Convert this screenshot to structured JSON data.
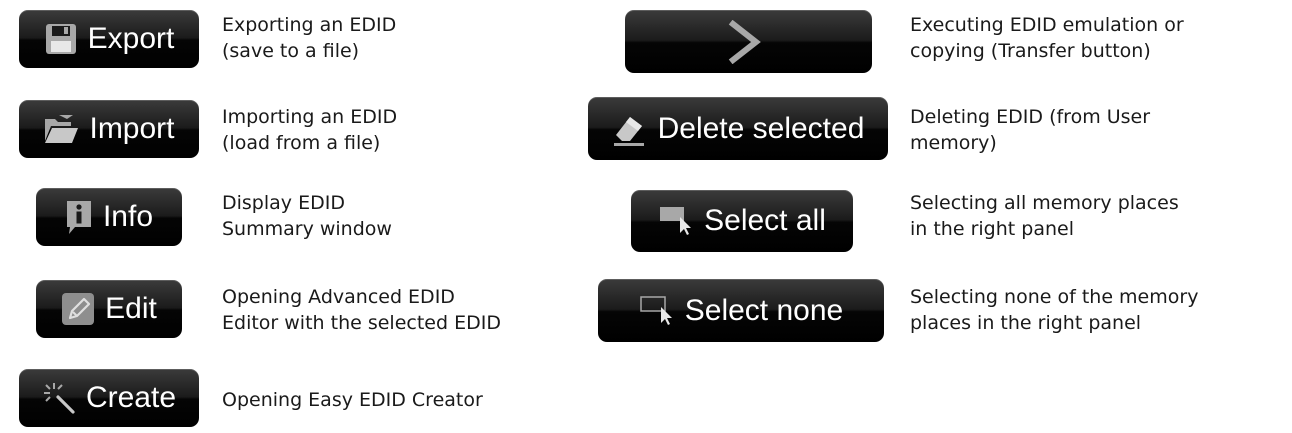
{
  "left_column": [
    {
      "label": "Export",
      "icon": "save-disk-icon",
      "desc": [
        "Exporting an EDID",
        "(save to a file)"
      ]
    },
    {
      "label": "Import",
      "icon": "open-folder-icon",
      "desc": [
        "Importing an EDID",
        "(load from a file)"
      ]
    },
    {
      "label": "Info",
      "icon": "info-bubble-icon",
      "desc": [
        "Display EDID",
        "Summary window"
      ]
    },
    {
      "label": "Edit",
      "icon": "pencil-icon",
      "desc": [
        "Opening Advanced EDID",
        "Editor with the selected EDID"
      ]
    },
    {
      "label": "Create",
      "icon": "magic-wand-icon",
      "desc": [
        "Opening Easy EDID Creator"
      ]
    }
  ],
  "right_column": [
    {
      "label": "",
      "icon": "chevron-right-icon",
      "desc": [
        "Executing EDID emulation or",
        "copying (Transfer button)"
      ]
    },
    {
      "label": "Delete selected",
      "icon": "eraser-icon",
      "desc": [
        "Deleting EDID (from User",
        "memory)"
      ]
    },
    {
      "label": "Select all",
      "icon": "select-all-icon",
      "desc": [
        "Selecting all memory places",
        "in the right panel"
      ]
    },
    {
      "label": "Select none",
      "icon": "select-none-icon",
      "desc": [
        "Selecting none of the memory",
        "places in the right panel"
      ]
    }
  ],
  "colors": {
    "button_bg": "#000000",
    "button_text": "#ffffff",
    "desc_text": "#1a1a1a",
    "icon_gray": "#a8a8a8"
  }
}
